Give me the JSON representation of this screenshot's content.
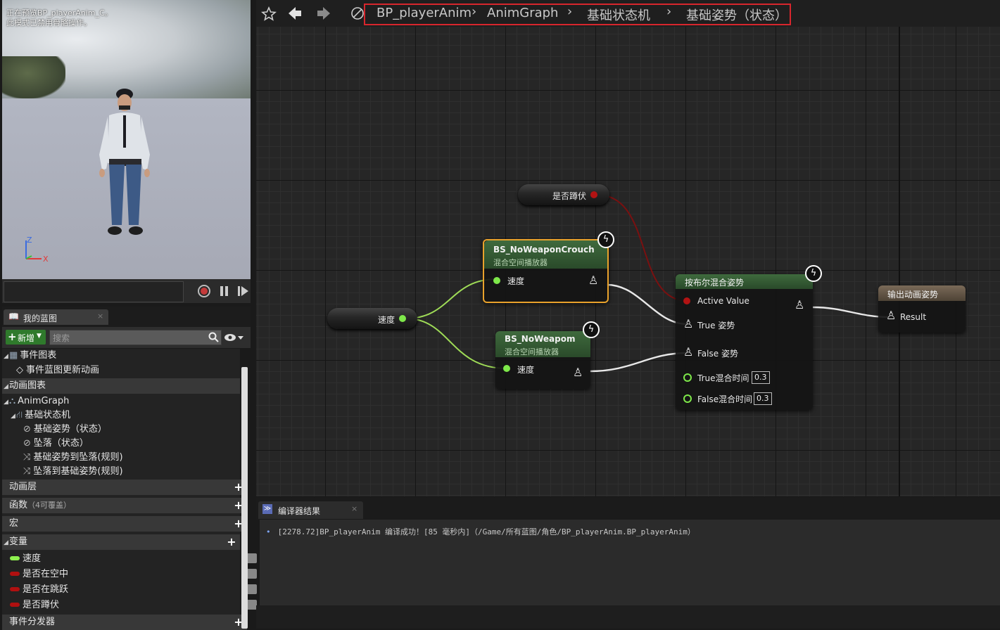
{
  "viewport": {
    "preview_line1": "正在预览BP_playerAnim_C。",
    "preview_line2": "此模式已禁用骨骼操作。",
    "axis_z": "Z",
    "axis_x": "X",
    "controls": [
      "record-icon",
      "pause-icon",
      "play-icon"
    ]
  },
  "my_blueprint": {
    "tab_label": "我的蓝图",
    "add_label": "新增",
    "search_placeholder": "搜索",
    "tree": [
      {
        "label": "事件图表",
        "kind": "category-plain"
      },
      {
        "label": "事件蓝图更新动画",
        "kind": "item"
      },
      {
        "label": "动画图表",
        "kind": "category"
      },
      {
        "label": "AnimGraph",
        "kind": "item"
      },
      {
        "label": "基础状态机",
        "kind": "item"
      },
      {
        "label": "基础姿势（状态）",
        "kind": "item"
      },
      {
        "label": "坠落（状态）",
        "kind": "item"
      },
      {
        "label": "基础姿势到坠落(规则)",
        "kind": "item"
      },
      {
        "label": "坠落到基础姿势(规则)",
        "kind": "item"
      },
      {
        "label": "动画层",
        "kind": "category"
      },
      {
        "label": "函数",
        "note": "（4可覆盖）",
        "kind": "category"
      },
      {
        "label": "宏",
        "kind": "category"
      },
      {
        "label": "变量",
        "kind": "category"
      },
      {
        "label": "速度",
        "kind": "var-float"
      },
      {
        "label": "是否在空中",
        "kind": "var-bool"
      },
      {
        "label": "是否在跳跃",
        "kind": "var-bool"
      },
      {
        "label": "是否蹲伏",
        "kind": "var-bool"
      },
      {
        "label": "事件分发器",
        "kind": "category"
      }
    ]
  },
  "breadcrumb": {
    "items": [
      "BP_playerAnim",
      "AnimGraph",
      "基础状态机",
      "基础姿势（状态）"
    ]
  },
  "graph": {
    "getter_crouch": "是否蹲伏",
    "getter_speed": "速度",
    "bs_crouch": {
      "title": "BS_NoWeaponCrouch",
      "subtitle": "混合空间播放器",
      "pin": "速度"
    },
    "bs_weapon": {
      "title": "BS_NoWeapom",
      "subtitle": "混合空间播放器",
      "pin": "速度"
    },
    "blend": {
      "title": "按布尔混合姿势",
      "pins": [
        "Active Value",
        "True 姿势",
        "False 姿势",
        "True混合时间",
        "False混合时间"
      ],
      "true_time": "0.3",
      "false_time": "0.3"
    },
    "output": {
      "title": "输出动画姿势",
      "pin": "Result"
    },
    "colors": {
      "float_pin": "#7ee84a",
      "bool_pin": "#a00b0b",
      "pose_wire": "#e8e8e8",
      "selected_border": "#e9a22c"
    }
  },
  "compiler": {
    "tab_label": "编译器结果",
    "message": "[2278.72]BP_playerAnim 编译成功！[85 毫秒内]（/Game/所有蓝图/角色/BP_playerAnim.BP_playerAnim）"
  }
}
